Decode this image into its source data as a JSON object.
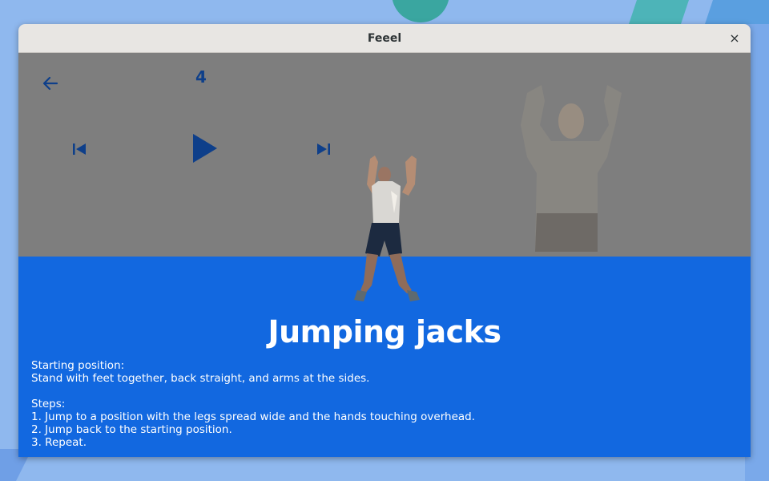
{
  "window": {
    "title": "Feeel",
    "close_glyph": "×"
  },
  "player": {
    "back_icon": "arrow-left-icon",
    "count": "4",
    "prev_icon": "skip-previous-icon",
    "play_icon": "play-icon",
    "next_icon": "skip-next-icon"
  },
  "exercise": {
    "name": "Jumping jacks",
    "starting_label": "Starting position:",
    "starting_text": "Stand with feet together, back straight, and arms at the sides.",
    "steps_label": "Steps:",
    "steps": [
      "1. Jump to a position with the legs spread wide and the hands touching overhead.",
      "2. Jump back to the starting position.",
      "3. Repeat."
    ]
  },
  "colors": {
    "stage_bg": "#7e7e7e",
    "accent_blue": "#1268e0",
    "control_blue": "#0e3f8a",
    "desktop_bg": "#8fb8ee"
  }
}
